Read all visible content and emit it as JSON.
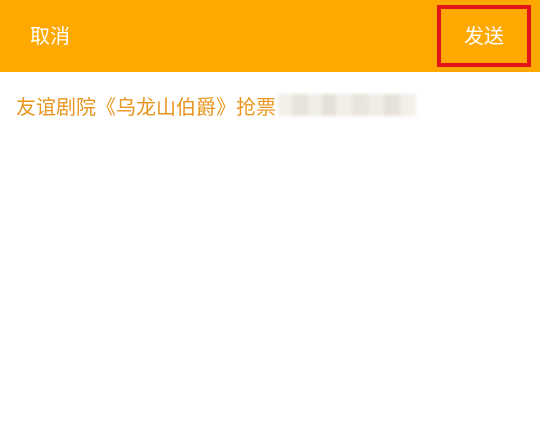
{
  "header": {
    "cancel_label": "取消",
    "send_label": "发送",
    "background_color": "#ffa800",
    "highlight_color": "#e8141c"
  },
  "compose": {
    "message_text": "友谊剧院《乌龙山伯爵》抢票",
    "text_color": "#e8951f"
  }
}
